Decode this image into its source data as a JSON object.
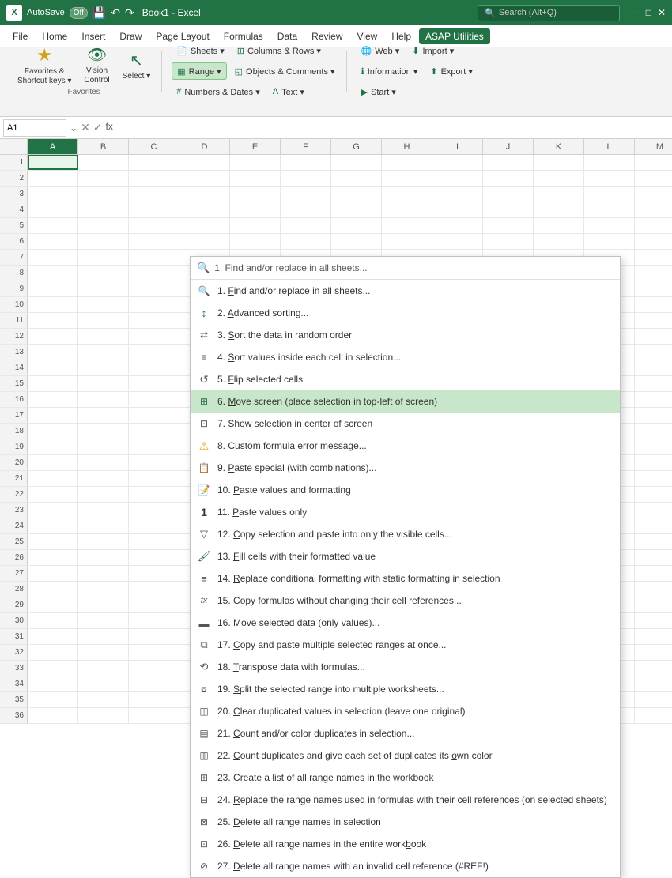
{
  "titlebar": {
    "app": "Excel",
    "autosave": "AutoSave",
    "toggle_state": "Off",
    "title": "Book1  -  Excel",
    "search_placeholder": "Search (Alt+Q)"
  },
  "menubar": {
    "items": [
      "File",
      "Home",
      "Insert",
      "Draw",
      "Page Layout",
      "Formulas",
      "Data",
      "Review",
      "View",
      "Help",
      "ASAP Utilities"
    ]
  },
  "ribbon": {
    "groups": [
      {
        "label": "Favorites",
        "buttons": [
          {
            "id": "favorites",
            "icon": "★",
            "label": "Favorites &\nShortcut keys"
          },
          {
            "id": "vision",
            "icon": "👁",
            "label": "Vision\nControl"
          },
          {
            "id": "select",
            "icon": "↖",
            "label": "Select"
          }
        ]
      },
      {
        "label": "",
        "buttons_row1": [
          {
            "id": "sheets",
            "label": "Sheets",
            "dropdown": true
          },
          {
            "id": "columns-rows",
            "label": "Columns & Rows",
            "dropdown": true
          }
        ],
        "buttons_row2": [
          {
            "id": "range",
            "label": "Range",
            "dropdown": true,
            "active": true
          },
          {
            "id": "objects-comments",
            "label": "Objects & Comments",
            "dropdown": true
          }
        ],
        "buttons_row3": [
          {
            "id": "numbers-dates",
            "label": "Numbers & Dates",
            "dropdown": true
          },
          {
            "id": "text",
            "label": "Text",
            "dropdown": true
          }
        ]
      },
      {
        "label": "",
        "buttons": [
          {
            "id": "web",
            "label": "Web",
            "dropdown": true
          },
          {
            "id": "information",
            "label": "Information",
            "dropdown": true
          },
          {
            "id": "import",
            "label": "Import",
            "dropdown": true
          },
          {
            "id": "export",
            "label": "Export",
            "dropdown": true
          },
          {
            "id": "start",
            "label": "Start",
            "dropdown": true
          }
        ]
      }
    ]
  },
  "formula_bar": {
    "cell_ref": "A1",
    "formula": ""
  },
  "columns": [
    "A",
    "B",
    "C",
    "D",
    "E",
    "F",
    "G",
    "H",
    "I",
    "J",
    "K",
    "L",
    "M"
  ],
  "rows": [
    1,
    2,
    3,
    4,
    5,
    6,
    7,
    8,
    9,
    10,
    11,
    12,
    13,
    14,
    15,
    16,
    17,
    18,
    19,
    20,
    21,
    22,
    23,
    24,
    25,
    26,
    27,
    28,
    29,
    30,
    31,
    32,
    33,
    34,
    35,
    36
  ],
  "dropdown": {
    "search_placeholder": "1. Find and/or replace in all sheets...",
    "items": [
      {
        "num": "1.",
        "underline_char": "F",
        "text": "ind and/or replace in all sheets...",
        "icon": "🔍",
        "icon_type": "search"
      },
      {
        "num": "2.",
        "underline_char": "A",
        "text": "dvanced sorting...",
        "icon": "↕",
        "icon_type": "sort"
      },
      {
        "num": "3.",
        "underline_char": "S",
        "text": "ort the data in random order",
        "icon": "🔀",
        "icon_type": "random"
      },
      {
        "num": "4.",
        "underline_char": "S",
        "text": "ort values inside each cell in selection...",
        "icon": "≡",
        "icon_type": "sort-cell"
      },
      {
        "num": "5.",
        "underline_char": "F",
        "text": "lip selected cells",
        "icon": "↺",
        "icon_type": "flip"
      },
      {
        "num": "6.",
        "underline_char": "M",
        "text": "ove screen (place selection in top-left of screen)",
        "icon": "⊞",
        "icon_type": "move-screen",
        "highlighted": true
      },
      {
        "num": "7.",
        "underline_char": "S",
        "text": "how selection in center of screen",
        "icon": "⊡",
        "icon_type": "center-screen"
      },
      {
        "num": "8.",
        "underline_char": "C",
        "text": "ustom formula error message...",
        "icon": "⚠",
        "icon_type": "warning"
      },
      {
        "num": "9.",
        "underline_char": "P",
        "text": "aste special (with combinations)...",
        "icon": "📋",
        "icon_type": "paste-special"
      },
      {
        "num": "10.",
        "underline_char": "P",
        "text": "aste values and formatting",
        "icon": "📝",
        "icon_type": "paste-format"
      },
      {
        "num": "11.",
        "underline_char": "P",
        "text": "aste values only",
        "icon": "1",
        "icon_type": "number"
      },
      {
        "num": "12.",
        "underline_char": "C",
        "text": "opy selection and paste into only the visible cells...",
        "icon": "▽",
        "icon_type": "filter-copy"
      },
      {
        "num": "13.",
        "underline_char": "F",
        "text": "ill cells with their formatted value",
        "icon": "🖌",
        "icon_type": "paint"
      },
      {
        "num": "14.",
        "underline_char": "R",
        "text": "eplace conditional formatting with static formatting in selection",
        "icon": "≡",
        "icon_type": "replace-format"
      },
      {
        "num": "15.",
        "underline_char": "C",
        "text": "opy formulas without changing their cell references...",
        "icon": "fx",
        "icon_type": "formula"
      },
      {
        "num": "16.",
        "underline_char": "M",
        "text": "ove selected data (only values)...",
        "icon": "▬",
        "icon_type": "move-data"
      },
      {
        "num": "17.",
        "underline_char": "C",
        "text": "opy and paste multiple selected ranges at once...",
        "icon": "⧉",
        "icon_type": "multi-copy"
      },
      {
        "num": "18.",
        "underline_char": "T",
        "text": "ranspose data with formulas...",
        "icon": "⟲",
        "icon_type": "transpose"
      },
      {
        "num": "19.",
        "underline_char": "S",
        "text": "plit the selected range into multiple worksheets...",
        "icon": "⧈",
        "icon_type": "split"
      },
      {
        "num": "20.",
        "underline_char": "C",
        "text": "lear duplicated values in selection (leave one original)",
        "icon": "◫",
        "icon_type": "clear-dupes"
      },
      {
        "num": "21.",
        "underline_char": "C",
        "text": "ount and/or color duplicates in selection...",
        "icon": "▤",
        "icon_type": "count-dupes"
      },
      {
        "num": "22.",
        "underline_char": "C",
        "text": "ount duplicates and give each set of duplicates its own color",
        "icon": "▥",
        "icon_type": "color-dupes"
      },
      {
        "num": "23.",
        "underline_char": "C",
        "text": "reate a list of all range names in the workbook",
        "icon": "⊞",
        "icon_type": "range-names"
      },
      {
        "num": "24.",
        "underline_char": "R",
        "text": "eplace the range names used in formulas with their cell references (on selected sheets)",
        "icon": "⊟",
        "icon_type": "replace-names"
      },
      {
        "num": "25.",
        "underline_char": "D",
        "text": "elete all range names in selection",
        "icon": "⊠",
        "icon_type": "delete-names-sel"
      },
      {
        "num": "26.",
        "underline_char": "D",
        "text": "elete all range names in the entire workbook",
        "icon": "⊡",
        "icon_type": "delete-names-wb"
      },
      {
        "num": "27.",
        "underline_char": "D",
        "text": "elete all range names with an invalid cell reference (#REF!)",
        "icon": "⊘",
        "icon_type": "delete-invalid"
      }
    ]
  }
}
